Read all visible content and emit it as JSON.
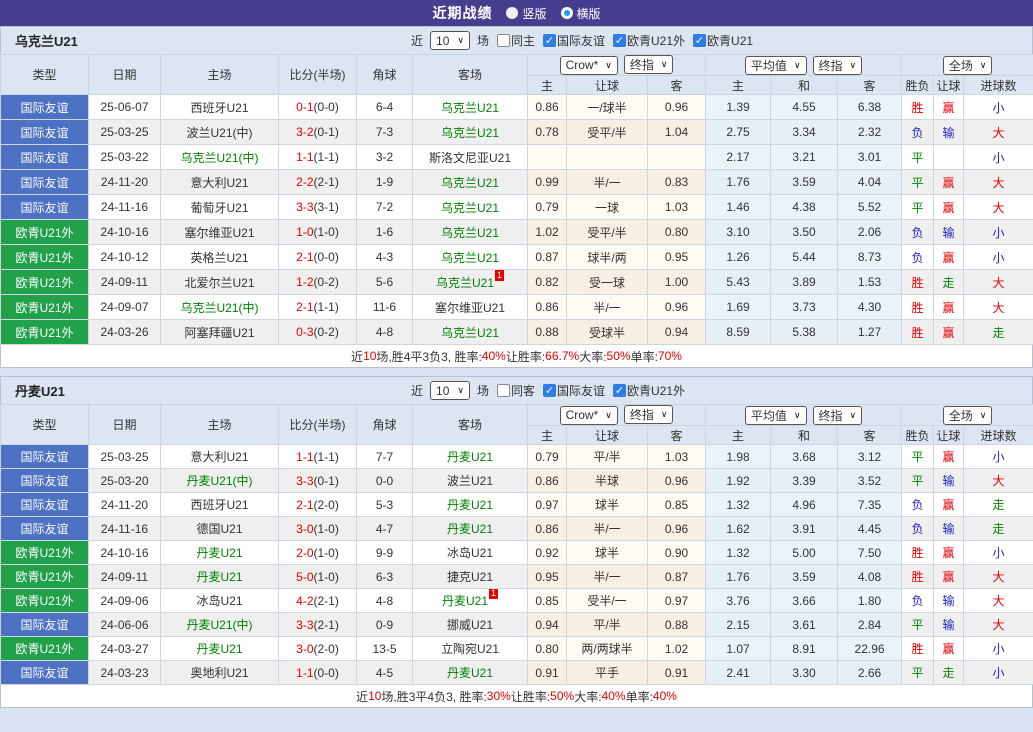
{
  "title_bar": {
    "title": "近期战绩",
    "options": [
      {
        "label": "竖版",
        "checked": false
      },
      {
        "label": "横版",
        "checked": true
      }
    ]
  },
  "table_header": {
    "static_cols": [
      "类型",
      "日期",
      "主场",
      "比分(半场)",
      "角球",
      "客场"
    ],
    "dropdowns": {
      "crow": "Crow*",
      "final1": "终指",
      "average": "平均值",
      "final2": "终指",
      "full": "全场"
    },
    "sub_cols": [
      "主",
      "让球",
      "客",
      "主",
      "和",
      "客",
      "胜负",
      "让球",
      "进球数"
    ]
  },
  "colors": {
    "title_bar_bg": "#473d8f",
    "type_friendly_blue": "#4d72c4",
    "type_qualifier_green": "#21a24a",
    "focus_team_green": "#008000",
    "score_red": "#e60000",
    "win_red": "#e60000",
    "draw_green": "#008800",
    "lose_blue": "#2222cc",
    "header_bg": "#dce5f2",
    "checkbox_blue": "#2d7ce8"
  },
  "sections": [
    {
      "team": "乌克兰U21",
      "filter": {
        "prefix": "近",
        "count": "10",
        "suffix": "场",
        "same_checkbox": {
          "label": "同主",
          "checked": false
        },
        "league_checkboxes": [
          {
            "label": "国际友谊",
            "checked": true
          },
          {
            "label": "欧青U21外",
            "checked": true
          },
          {
            "label": "欧青U21",
            "checked": true
          }
        ]
      },
      "rows": [
        {
          "type": "国际友谊",
          "type_color": "blue",
          "date": "25-06-07",
          "home": "西班牙U21",
          "home_focus": false,
          "home_card": "",
          "score": "0-1",
          "half": "(0-0)",
          "corner": "6-4",
          "away": "乌克兰U21",
          "away_focus": true,
          "away_card": "",
          "crow_home": "0.86",
          "crow_line": "一/球半",
          "crow_away": "0.96",
          "avg_home": "1.39",
          "avg_draw": "4.55",
          "avg_away": "6.38",
          "result": "胜",
          "result_color": "red",
          "handicap": "赢",
          "handicap_color": "red",
          "goals": "小",
          "goals_color": "blue"
        },
        {
          "type": "国际友谊",
          "type_color": "blue",
          "date": "25-03-25",
          "home": "波兰U21(中)",
          "home_focus": false,
          "home_card": "",
          "score": "3-2",
          "half": "(0-1)",
          "corner": "7-3",
          "away": "乌克兰U21",
          "away_focus": true,
          "away_card": "",
          "crow_home": "0.78",
          "crow_line": "受平/半",
          "crow_away": "1.04",
          "avg_home": "2.75",
          "avg_draw": "3.34",
          "avg_away": "2.32",
          "result": "负",
          "result_color": "blue",
          "handicap": "输",
          "handicap_color": "blue",
          "goals": "大",
          "goals_color": "red"
        },
        {
          "type": "国际友谊",
          "type_color": "blue",
          "date": "25-03-22",
          "home": "乌克兰U21(中)",
          "home_focus": true,
          "home_card": "",
          "score": "1-1",
          "half": "(1-1)",
          "corner": "3-2",
          "away": "斯洛文尼亚U21",
          "away_focus": false,
          "away_card": "",
          "crow_home": "",
          "crow_line": "",
          "crow_away": "",
          "avg_home": "2.17",
          "avg_draw": "3.21",
          "avg_away": "3.01",
          "result": "平",
          "result_color": "green",
          "handicap": "",
          "handicap_color": "red",
          "goals": "小",
          "goals_color": "blue"
        },
        {
          "type": "国际友谊",
          "type_color": "blue",
          "date": "24-11-20",
          "home": "意大利U21",
          "home_focus": false,
          "home_card": "",
          "score": "2-2",
          "half": "(2-1)",
          "corner": "1-9",
          "away": "乌克兰U21",
          "away_focus": true,
          "away_card": "",
          "crow_home": "0.99",
          "crow_line": "半/一",
          "crow_away": "0.83",
          "avg_home": "1.76",
          "avg_draw": "3.59",
          "avg_away": "4.04",
          "result": "平",
          "result_color": "green",
          "handicap": "赢",
          "handicap_color": "red",
          "goals": "大",
          "goals_color": "red"
        },
        {
          "type": "国际友谊",
          "type_color": "blue",
          "date": "24-11-16",
          "home": "葡萄牙U21",
          "home_focus": false,
          "home_card": "",
          "score": "3-3",
          "half": "(3-1)",
          "corner": "7-2",
          "away": "乌克兰U21",
          "away_focus": true,
          "away_card": "",
          "crow_home": "0.79",
          "crow_line": "一球",
          "crow_away": "1.03",
          "avg_home": "1.46",
          "avg_draw": "4.38",
          "avg_away": "5.52",
          "result": "平",
          "result_color": "green",
          "handicap": "赢",
          "handicap_color": "red",
          "goals": "大",
          "goals_color": "red"
        },
        {
          "type": "欧青U21外",
          "type_color": "green",
          "date": "24-10-16",
          "home": "塞尔维亚U21",
          "home_focus": false,
          "home_card": "",
          "score": "1-0",
          "half": "(1-0)",
          "corner": "1-6",
          "away": "乌克兰U21",
          "away_focus": true,
          "away_card": "",
          "crow_home": "1.02",
          "crow_line": "受平/半",
          "crow_away": "0.80",
          "avg_home": "3.10",
          "avg_draw": "3.50",
          "avg_away": "2.06",
          "result": "负",
          "result_color": "blue",
          "handicap": "输",
          "handicap_color": "blue",
          "goals": "小",
          "goals_color": "blue"
        },
        {
          "type": "欧青U21外",
          "type_color": "green",
          "date": "24-10-12",
          "home": "英格兰U21",
          "home_focus": false,
          "home_card": "",
          "score": "2-1",
          "half": "(0-0)",
          "corner": "4-3",
          "away": "乌克兰U21",
          "away_focus": true,
          "away_card": "",
          "crow_home": "0.87",
          "crow_line": "球半/两",
          "crow_away": "0.95",
          "avg_home": "1.26",
          "avg_draw": "5.44",
          "avg_away": "8.73",
          "result": "负",
          "result_color": "blue",
          "handicap": "赢",
          "handicap_color": "red",
          "goals": "小",
          "goals_color": "blue"
        },
        {
          "type": "欧青U21外",
          "type_color": "green",
          "date": "24-09-11",
          "home": "北爱尔兰U21",
          "home_focus": false,
          "home_card": "",
          "score": "1-2",
          "half": "(0-2)",
          "corner": "5-6",
          "away": "乌克兰U21",
          "away_focus": true,
          "away_card": "1",
          "crow_home": "0.82",
          "crow_line": "受一球",
          "crow_away": "1.00",
          "avg_home": "5.43",
          "avg_draw": "3.89",
          "avg_away": "1.53",
          "result": "胜",
          "result_color": "red",
          "handicap": "走",
          "handicap_color": "green",
          "goals": "大",
          "goals_color": "red"
        },
        {
          "type": "欧青U21外",
          "type_color": "green",
          "date": "24-09-07",
          "home": "乌克兰U21(中)",
          "home_focus": true,
          "home_card": "",
          "score": "2-1",
          "half": "(1-1)",
          "corner": "11-6",
          "away": "塞尔维亚U21",
          "away_focus": false,
          "away_card": "",
          "crow_home": "0.86",
          "crow_line": "半/一",
          "crow_away": "0.96",
          "avg_home": "1.69",
          "avg_draw": "3.73",
          "avg_away": "4.30",
          "result": "胜",
          "result_color": "red",
          "handicap": "赢",
          "handicap_color": "red",
          "goals": "大",
          "goals_color": "red"
        },
        {
          "type": "欧青U21外",
          "type_color": "green",
          "date": "24-03-26",
          "home": "阿塞拜疆U21",
          "home_focus": false,
          "home_card": "",
          "score": "0-3",
          "half": "(0-2)",
          "corner": "4-8",
          "away": "乌克兰U21",
          "away_focus": true,
          "away_card": "",
          "crow_home": "0.88",
          "crow_line": "受球半",
          "crow_away": "0.94",
          "avg_home": "8.59",
          "avg_draw": "5.38",
          "avg_away": "1.27",
          "result": "胜",
          "result_color": "red",
          "handicap": "赢",
          "handicap_color": "red",
          "goals": "走",
          "goals_color": "green"
        }
      ],
      "summary": [
        {
          "text": "近",
          "red": false
        },
        {
          "text": "10",
          "red": true
        },
        {
          "text": "场,胜4平3负3, 胜率:",
          "red": false
        },
        {
          "text": "40%",
          "red": true
        },
        {
          "text": " 让胜率:",
          "red": false
        },
        {
          "text": "66.7%",
          "red": true
        },
        {
          "text": " 大率:",
          "red": false
        },
        {
          "text": "50%",
          "red": true
        },
        {
          "text": " 单率:",
          "red": false
        },
        {
          "text": "70%",
          "red": true
        }
      ]
    },
    {
      "team": "丹麦U21",
      "filter": {
        "prefix": "近",
        "count": "10",
        "suffix": "场",
        "same_checkbox": {
          "label": "同客",
          "checked": false
        },
        "league_checkboxes": [
          {
            "label": "国际友谊",
            "checked": true
          },
          {
            "label": "欧青U21外",
            "checked": true
          }
        ]
      },
      "rows": [
        {
          "type": "国际友谊",
          "type_color": "blue",
          "date": "25-03-25",
          "home": "意大利U21",
          "home_focus": false,
          "home_card": "",
          "score": "1-1",
          "half": "(1-1)",
          "corner": "7-7",
          "away": "丹麦U21",
          "away_focus": true,
          "away_card": "",
          "crow_home": "0.79",
          "crow_line": "平/半",
          "crow_away": "1.03",
          "avg_home": "1.98",
          "avg_draw": "3.68",
          "avg_away": "3.12",
          "result": "平",
          "result_color": "green",
          "handicap": "赢",
          "handicap_color": "red",
          "goals": "小",
          "goals_color": "blue"
        },
        {
          "type": "国际友谊",
          "type_color": "blue",
          "date": "25-03-20",
          "home": "丹麦U21(中)",
          "home_focus": true,
          "home_card": "",
          "score": "3-3",
          "half": "(0-1)",
          "corner": "0-0",
          "away": "波兰U21",
          "away_focus": false,
          "away_card": "",
          "crow_home": "0.86",
          "crow_line": "半球",
          "crow_away": "0.96",
          "avg_home": "1.92",
          "avg_draw": "3.39",
          "avg_away": "3.52",
          "result": "平",
          "result_color": "green",
          "handicap": "输",
          "handicap_color": "blue",
          "goals": "大",
          "goals_color": "red"
        },
        {
          "type": "国际友谊",
          "type_color": "blue",
          "date": "24-11-20",
          "home": "西班牙U21",
          "home_focus": false,
          "home_card": "",
          "score": "2-1",
          "half": "(2-0)",
          "corner": "5-3",
          "away": "丹麦U21",
          "away_focus": true,
          "away_card": "",
          "crow_home": "0.97",
          "crow_line": "球半",
          "crow_away": "0.85",
          "avg_home": "1.32",
          "avg_draw": "4.96",
          "avg_away": "7.35",
          "result": "负",
          "result_color": "blue",
          "handicap": "赢",
          "handicap_color": "red",
          "goals": "走",
          "goals_color": "green"
        },
        {
          "type": "国际友谊",
          "type_color": "blue",
          "date": "24-11-16",
          "home": "德国U21",
          "home_focus": false,
          "home_card": "",
          "score": "3-0",
          "half": "(1-0)",
          "corner": "4-7",
          "away": "丹麦U21",
          "away_focus": true,
          "away_card": "",
          "crow_home": "0.86",
          "crow_line": "半/一",
          "crow_away": "0.96",
          "avg_home": "1.62",
          "avg_draw": "3.91",
          "avg_away": "4.45",
          "result": "负",
          "result_color": "blue",
          "handicap": "输",
          "handicap_color": "blue",
          "goals": "走",
          "goals_color": "green"
        },
        {
          "type": "欧青U21外",
          "type_color": "green",
          "date": "24-10-16",
          "home": "丹麦U21",
          "home_focus": true,
          "home_card": "",
          "score": "2-0",
          "half": "(1-0)",
          "corner": "9-9",
          "away": "冰岛U21",
          "away_focus": false,
          "away_card": "",
          "crow_home": "0.92",
          "crow_line": "球半",
          "crow_away": "0.90",
          "avg_home": "1.32",
          "avg_draw": "5.00",
          "avg_away": "7.50",
          "result": "胜",
          "result_color": "red",
          "handicap": "赢",
          "handicap_color": "red",
          "goals": "小",
          "goals_color": "blue"
        },
        {
          "type": "欧青U21外",
          "type_color": "green",
          "date": "24-09-11",
          "home": "丹麦U21",
          "home_focus": true,
          "home_card": "",
          "score": "5-0",
          "half": "(1-0)",
          "corner": "6-3",
          "away": "捷克U21",
          "away_focus": false,
          "away_card": "",
          "crow_home": "0.95",
          "crow_line": "半/一",
          "crow_away": "0.87",
          "avg_home": "1.76",
          "avg_draw": "3.59",
          "avg_away": "4.08",
          "result": "胜",
          "result_color": "red",
          "handicap": "赢",
          "handicap_color": "red",
          "goals": "大",
          "goals_color": "red"
        },
        {
          "type": "欧青U21外",
          "type_color": "green",
          "date": "24-09-06",
          "home": "冰岛U21",
          "home_focus": false,
          "home_card": "",
          "score": "4-2",
          "half": "(2-1)",
          "corner": "4-8",
          "away": "丹麦U21",
          "away_focus": true,
          "away_card": "1",
          "crow_home": "0.85",
          "crow_line": "受半/一",
          "crow_away": "0.97",
          "avg_home": "3.76",
          "avg_draw": "3.66",
          "avg_away": "1.80",
          "result": "负",
          "result_color": "blue",
          "handicap": "输",
          "handicap_color": "blue",
          "goals": "大",
          "goals_color": "red"
        },
        {
          "type": "国际友谊",
          "type_color": "blue",
          "date": "24-06-06",
          "home": "丹麦U21(中)",
          "home_focus": true,
          "home_card": "",
          "score": "3-3",
          "half": "(2-1)",
          "corner": "0-9",
          "away": "挪威U21",
          "away_focus": false,
          "away_card": "",
          "crow_home": "0.94",
          "crow_line": "平/半",
          "crow_away": "0.88",
          "avg_home": "2.15",
          "avg_draw": "3.61",
          "avg_away": "2.84",
          "result": "平",
          "result_color": "green",
          "handicap": "输",
          "handicap_color": "blue",
          "goals": "大",
          "goals_color": "red"
        },
        {
          "type": "欧青U21外",
          "type_color": "green",
          "date": "24-03-27",
          "home": "丹麦U21",
          "home_focus": true,
          "home_card": "",
          "score": "3-0",
          "half": "(2-0)",
          "corner": "13-5",
          "away": "立陶宛U21",
          "away_focus": false,
          "away_card": "",
          "crow_home": "0.80",
          "crow_line": "两/两球半",
          "crow_away": "1.02",
          "avg_home": "1.07",
          "avg_draw": "8.91",
          "avg_away": "22.96",
          "result": "胜",
          "result_color": "red",
          "handicap": "赢",
          "handicap_color": "red",
          "goals": "小",
          "goals_color": "blue"
        },
        {
          "type": "国际友谊",
          "type_color": "blue",
          "date": "24-03-23",
          "home": "奥地利U21",
          "home_focus": false,
          "home_card": "",
          "score": "1-1",
          "half": "(0-0)",
          "corner": "4-5",
          "away": "丹麦U21",
          "away_focus": true,
          "away_card": "",
          "crow_home": "0.91",
          "crow_line": "平手",
          "crow_away": "0.91",
          "avg_home": "2.41",
          "avg_draw": "3.30",
          "avg_away": "2.66",
          "result": "平",
          "result_color": "green",
          "handicap": "走",
          "handicap_color": "green",
          "goals": "小",
          "goals_color": "blue"
        }
      ],
      "summary": [
        {
          "text": "近",
          "red": false
        },
        {
          "text": "10",
          "red": true
        },
        {
          "text": "场,胜3平4负3, 胜率:",
          "red": false
        },
        {
          "text": "30%",
          "red": true
        },
        {
          "text": " 让胜率:",
          "red": false
        },
        {
          "text": "50%",
          "red": true
        },
        {
          "text": " 大率:",
          "red": false
        },
        {
          "text": "40%",
          "red": true
        },
        {
          "text": " 单率:",
          "red": false
        },
        {
          "text": "40%",
          "red": true
        }
      ]
    }
  ]
}
